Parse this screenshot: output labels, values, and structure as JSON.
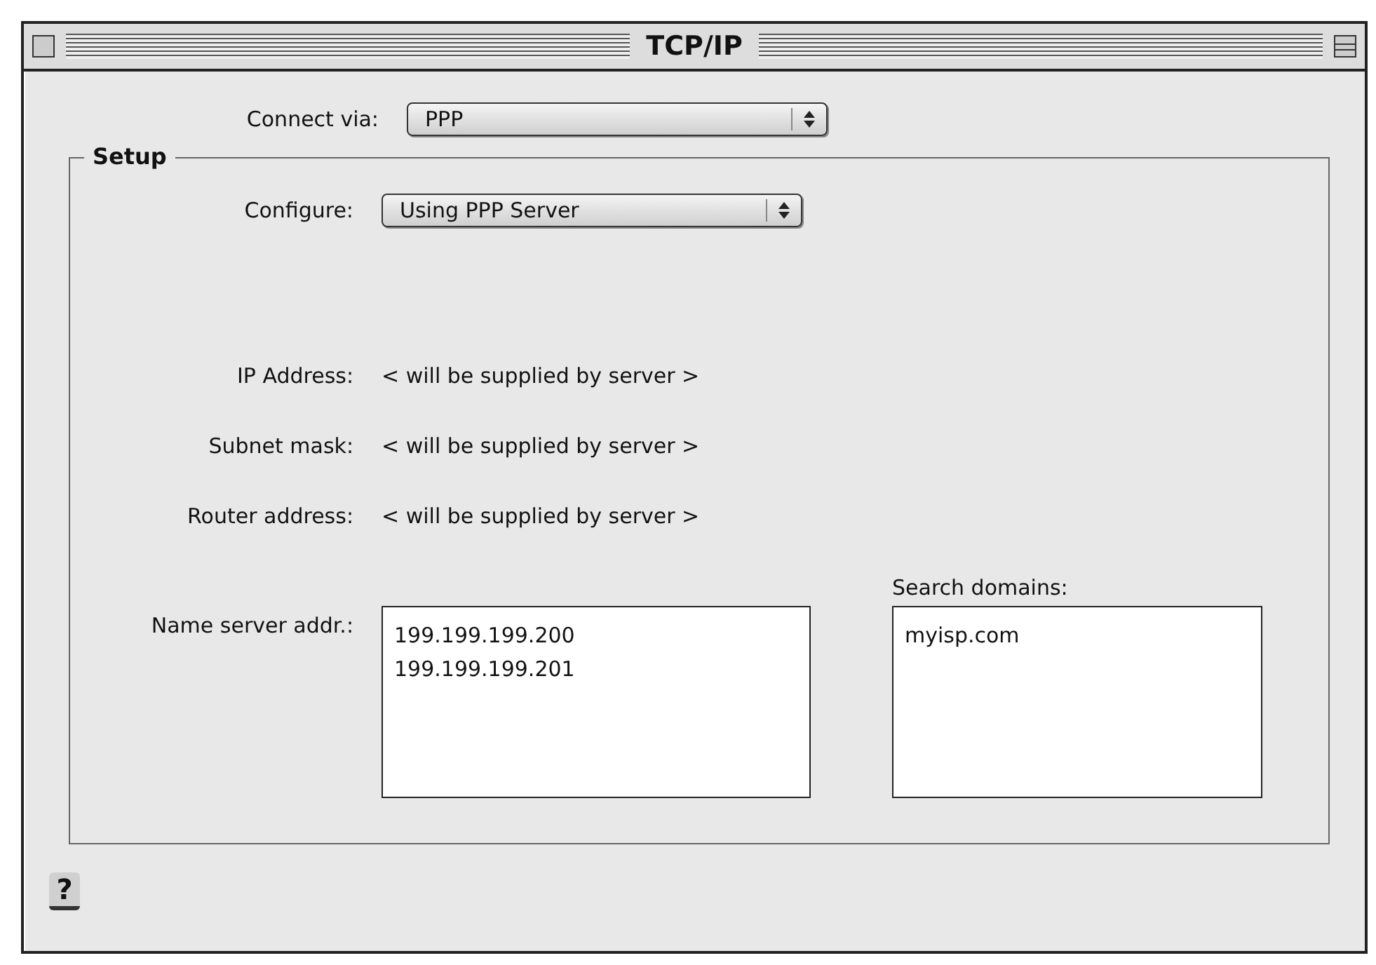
{
  "window": {
    "title": "TCP/IP"
  },
  "connect_via": {
    "label": "Connect via:",
    "value": "PPP"
  },
  "setup": {
    "title": "Setup",
    "configure": {
      "label": "Configure:",
      "value": "Using PPP Server"
    },
    "fields": [
      {
        "label": "IP Address:",
        "value": "< will be supplied by server >"
      },
      {
        "label": "Subnet mask:",
        "value": "< will be supplied by server >"
      },
      {
        "label": "Router address:",
        "value": "< will be supplied by server >"
      }
    ],
    "name_server": {
      "label": "Name server addr.:",
      "lines": [
        "199.199.199.200",
        "199.199.199.201"
      ]
    },
    "search_domains": {
      "label": "Search domains:",
      "lines": [
        "myisp.com"
      ]
    }
  },
  "help": {
    "glyph": "?"
  }
}
